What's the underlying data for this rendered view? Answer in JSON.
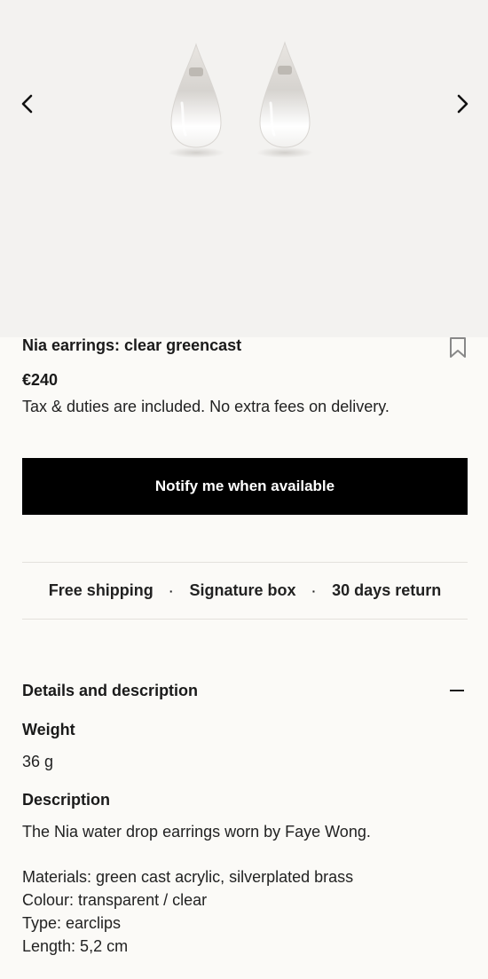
{
  "gallery": {
    "prev_icon": "chevron-left-icon",
    "next_icon": "chevron-right-icon"
  },
  "product": {
    "title": "Nia earrings: clear greencast",
    "price": "€240",
    "tax_note": "Tax & duties are included. No extra fees on delivery.",
    "bookmark_icon": "bookmark-icon"
  },
  "cta": {
    "notify_label": "Notify me when available"
  },
  "perks": {
    "items": [
      "Free shipping",
      "Signature box",
      "30 days return"
    ],
    "separator": "·"
  },
  "details": {
    "title": "Details and description",
    "toggle_icon": "minus-icon",
    "weight_label": "Weight",
    "weight_value": "36 g",
    "description_label": "Description",
    "description_text": "The Nia water drop earrings worn by Faye Wong.",
    "specs": [
      "Materials: green cast acrylic, silverplated brass",
      "Colour: transparent / clear",
      "Type: earclips",
      "Length: 5,2 cm"
    ]
  },
  "colors": {
    "background": "#fbfaf7",
    "gallery_background": "#f3f2f0",
    "button": "#000000",
    "button_text": "#ffffff"
  }
}
